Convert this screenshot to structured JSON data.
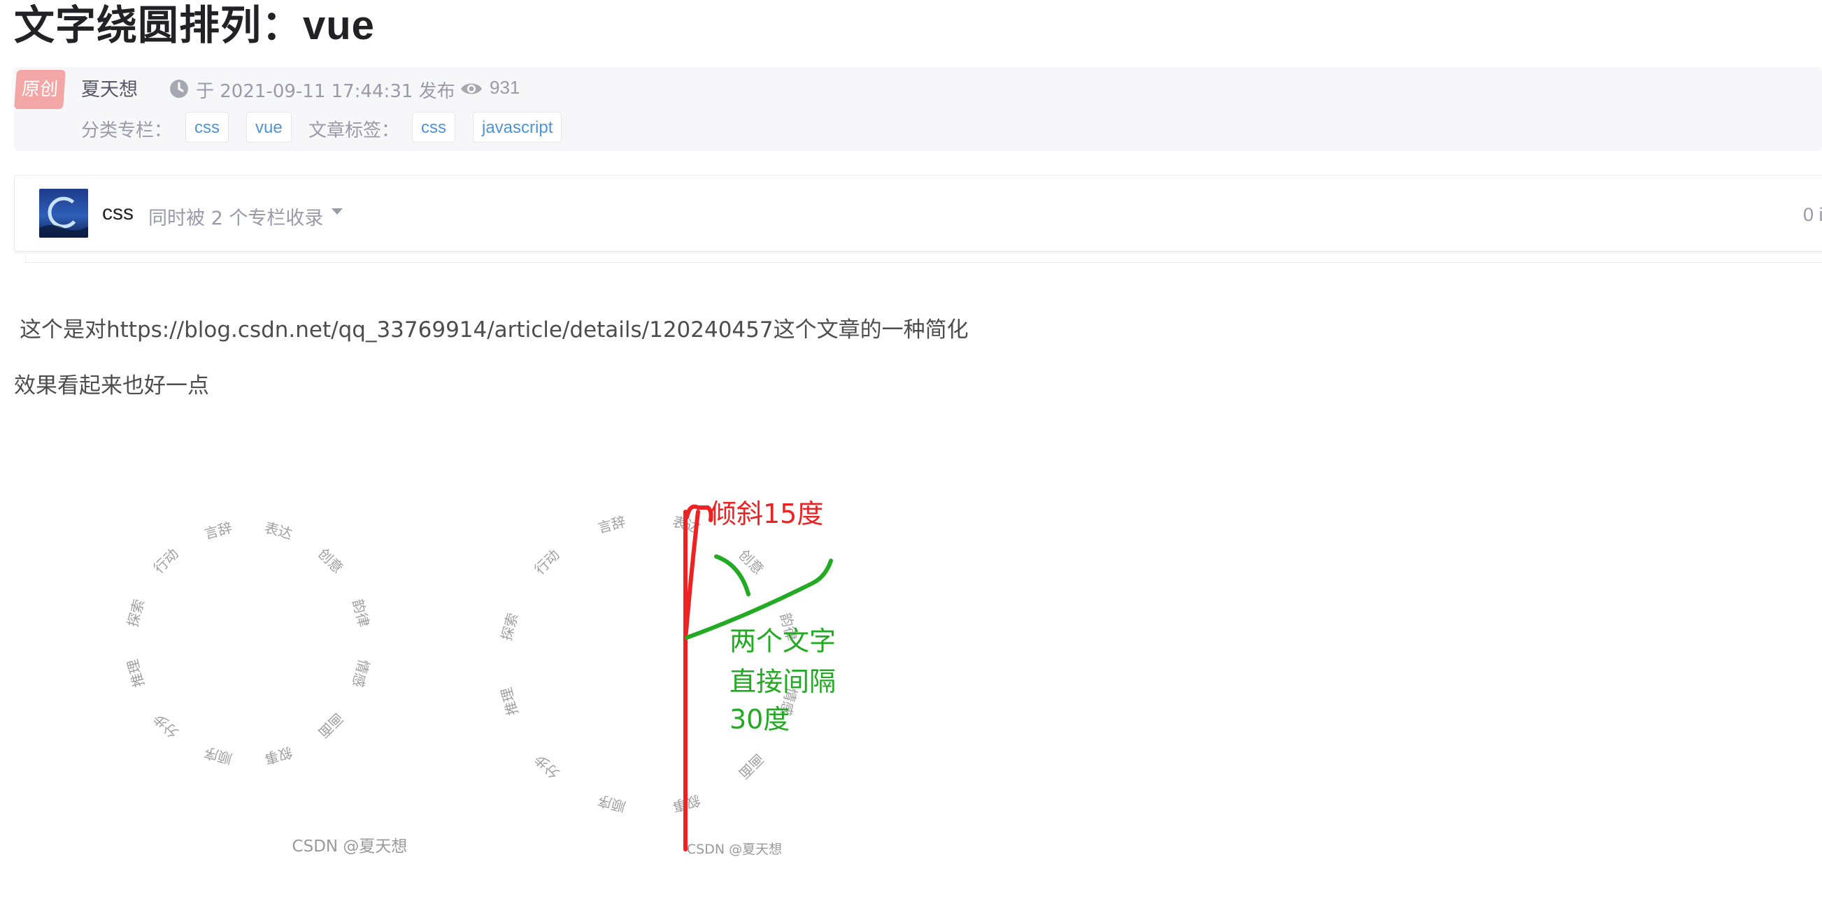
{
  "article": {
    "title": "文字绕圆排列：vue",
    "badge": "原创",
    "author": "夏天想",
    "publish_time": "于 2021-09-11 17:44:31 发布",
    "views": "931",
    "category_label": "分类专栏：",
    "categories": [
      "css",
      "vue"
    ],
    "tags_label": "文章标签：",
    "tags": [
      "css",
      "javascript"
    ]
  },
  "column_card": {
    "name": "css",
    "collect_text": "同时被 2 个专栏收录",
    "count_text": "0 i"
  },
  "content": {
    "paragraph1": "这个是对https://blog.csdn.net/qq_33769914/article/details/120240457这个文章的一种简化",
    "paragraph2": "效果看起来也好一点"
  },
  "figure": {
    "ring_words": [
      "言辞",
      "表达",
      "创意",
      "韵律",
      "情感",
      "画面",
      "叙事",
      "顺序",
      "分步",
      "推理",
      "探索",
      "行动"
    ],
    "watermark_left": "CSDN @夏天想",
    "watermark_right": "CSDN @夏天想",
    "annotation_red": "倾斜15度",
    "annotation_green_lines": [
      "两个文字",
      "直接间隔",
      "30度"
    ],
    "colors": {
      "red": "#ee2222",
      "green": "#22aa22",
      "ring_text": "#a0a0a0"
    }
  },
  "icons": {
    "clock": "clock-icon",
    "eye": "eye-icon",
    "caret": "caret-down-icon"
  }
}
